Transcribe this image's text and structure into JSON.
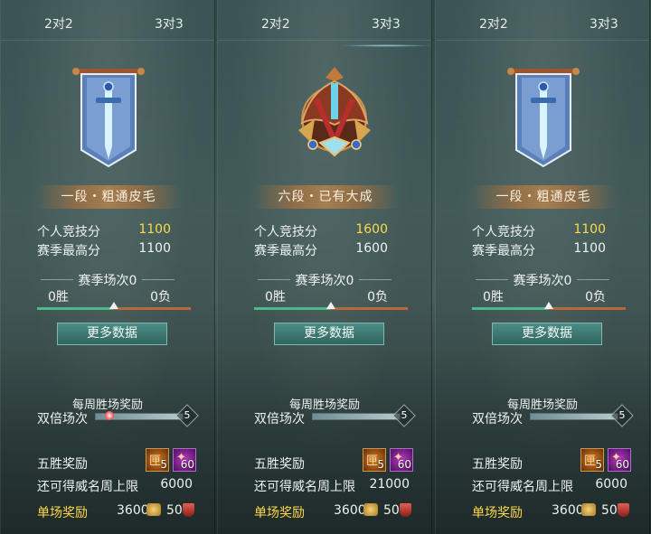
{
  "panels": [
    {
      "tabs": [
        {
          "label": "2对2",
          "active": false
        },
        {
          "label": "3对3",
          "active": false
        }
      ],
      "rank_title": "一段・粗通皮毛",
      "personal_score_label": "个人竞技分",
      "personal_score": "1100",
      "season_high_label": "赛季最高分",
      "season_high": "1100",
      "season_matches_label": "赛季场次0",
      "wins": "0胜",
      "losses": "0负",
      "more_data_label": "更多数据",
      "weekly_title": "每周胜场奖励",
      "double_label": "双倍场次",
      "double_max": "5",
      "five_win_label": "五胜奖励",
      "item1_count": "5",
      "item2_count": "60",
      "weekly_cap_label": "还可得威名周上限",
      "weekly_cap": "6000",
      "single_label": "单场奖励",
      "single_coin": "3600",
      "single_honor": "50"
    },
    {
      "tabs": [
        {
          "label": "2对2",
          "active": false
        },
        {
          "label": "3对3",
          "active": true
        }
      ],
      "rank_title": "六段・已有大成",
      "personal_score_label": "个人竞技分",
      "personal_score": "1600",
      "season_high_label": "赛季最高分",
      "season_high": "1600",
      "season_matches_label": "赛季场次0",
      "wins": "0胜",
      "losses": "0负",
      "more_data_label": "更多数据",
      "weekly_title": "每周胜场奖励",
      "double_label": "双倍场次",
      "double_max": "5",
      "five_win_label": "五胜奖励",
      "item1_count": "5",
      "item2_count": "60",
      "weekly_cap_label": "还可得威名周上限",
      "weekly_cap": "21000",
      "single_label": "单场奖励",
      "single_coin": "3600",
      "single_honor": "50"
    },
    {
      "tabs": [
        {
          "label": "2对2",
          "active": false
        },
        {
          "label": "3对3",
          "active": false
        }
      ],
      "rank_title": "一段・粗通皮毛",
      "personal_score_label": "个人竞技分",
      "personal_score": "1100",
      "season_high_label": "赛季最高分",
      "season_high": "1100",
      "season_matches_label": "赛季场次0",
      "wins": "0胜",
      "losses": "0负",
      "more_data_label": "更多数据",
      "weekly_title": "每周胜场奖励",
      "double_label": "双倍场次",
      "double_max": "5",
      "five_win_label": "五胜奖励",
      "item1_count": "5",
      "item2_count": "60",
      "weekly_cap_label": "还可得威名周上限",
      "weekly_cap": "6000",
      "single_label": "单场奖励",
      "single_coin": "3600",
      "single_honor": "50"
    }
  ],
  "icons": {
    "emblem_low": "blue-sword-banner-emblem",
    "emblem_high": "bronze-crest-emblem",
    "item1": "orange-chest-item-icon",
    "item2": "purple-crystal-item-icon",
    "coin": "coin-icon",
    "honor": "red-shield-icon"
  },
  "colors": {
    "score_gold": "#ffd94a",
    "win_bar": "#4fb88a",
    "loss_bar": "#b8683e",
    "button": "#3d7a72"
  }
}
